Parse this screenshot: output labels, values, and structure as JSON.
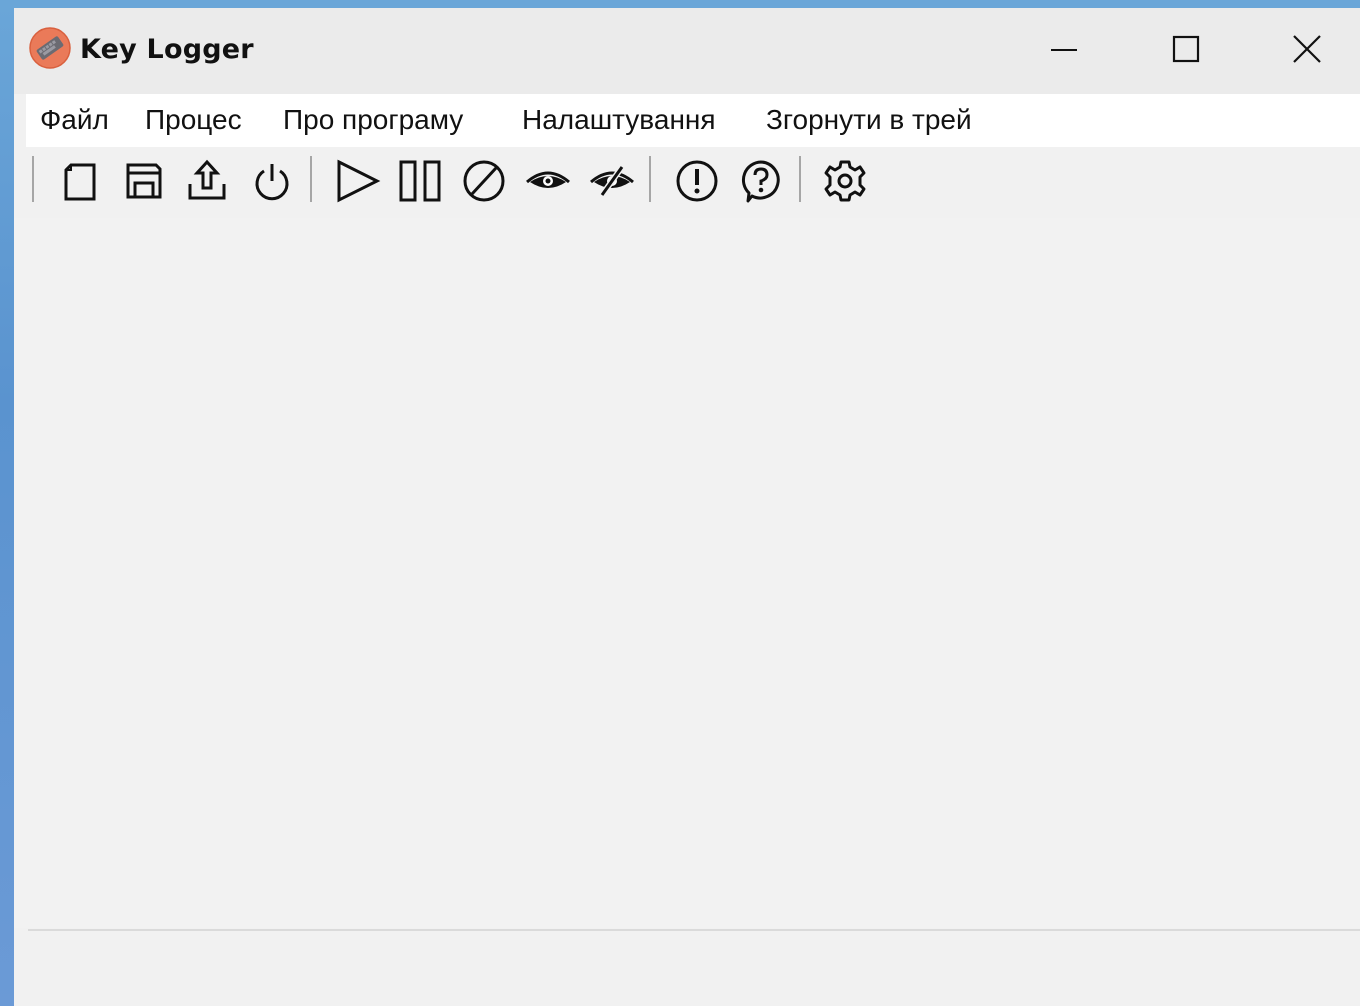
{
  "window": {
    "title": "Key Logger",
    "buttons": {
      "minimize_icon": "minimize-icon",
      "maximize_icon": "maximize-icon",
      "close_icon": "close-icon"
    }
  },
  "menu": {
    "items": [
      {
        "label": "Файл"
      },
      {
        "label": "Процес"
      },
      {
        "label": "Про програму"
      },
      {
        "label": "Налаштування"
      },
      {
        "label": "Згорнути в трей"
      }
    ]
  },
  "toolbar": {
    "icons": [
      "new-file-icon",
      "save-icon",
      "upload-icon",
      "power-icon",
      "play-icon",
      "pause-icon",
      "stop-icon",
      "show-icon",
      "hide-icon",
      "info-icon",
      "help-icon",
      "settings-icon"
    ]
  },
  "colors": {
    "desktop": "#5a93cf",
    "window_bg": "#f1f1f1",
    "titlebar_bg": "#ebebeb",
    "menubar_bg": "#ffffff",
    "app_icon": "#e8714f"
  }
}
